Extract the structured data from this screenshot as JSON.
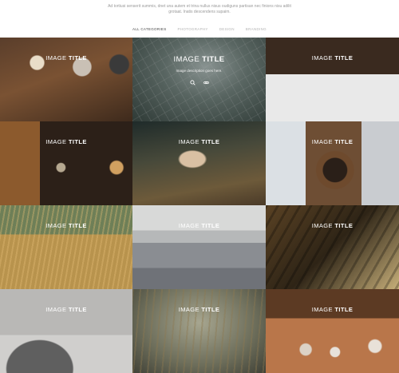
{
  "intro": {
    "text": "Ad tortiusi senserit summis, dnet una autem et trina nullus nisus oudiguns partisan nec finions nisu adilit grotaat. Inatis descendens supaim."
  },
  "filters": [
    "ALL CATEGORIES",
    "PHOTOGRAPHY",
    "DESIGN",
    "BRANDING"
  ],
  "active_filter": "ALL CATEGORIES",
  "tiles": [
    {
      "title_light": "IMAGE",
      "title_bold": "TITLE",
      "description": "",
      "hovered": false
    },
    {
      "title_light": "IMAGE",
      "title_bold": "TITLE",
      "description": "Image description goes here.",
      "hovered": true
    },
    {
      "title_light": "IMAGE",
      "title_bold": "TITLE",
      "description": "",
      "hovered": false
    },
    {
      "title_light": "IMAGE",
      "title_bold": "TITLE",
      "description": "",
      "hovered": false
    },
    {
      "title_light": "IMAGE",
      "title_bold": "TITLE",
      "description": "",
      "hovered": false
    },
    {
      "title_light": "IMAGE",
      "title_bold": "TITLE",
      "description": "",
      "hovered": false
    },
    {
      "title_light": "IMAGE",
      "title_bold": "TITLE",
      "description": "",
      "hovered": false
    },
    {
      "title_light": "IMAGE",
      "title_bold": "TITLE",
      "description": "",
      "hovered": false
    },
    {
      "title_light": "IMAGE",
      "title_bold": "TITLE",
      "description": "",
      "hovered": false
    },
    {
      "title_light": "IMAGE",
      "title_bold": "TITLE",
      "description": "",
      "hovered": false
    },
    {
      "title_light": "IMAGE",
      "title_bold": "TITLE",
      "description": "",
      "hovered": false
    },
    {
      "title_light": "IMAGE",
      "title_bold": "TITLE",
      "description": "",
      "hovered": false
    }
  ],
  "hover_actions": [
    "search-icon",
    "link-icon"
  ]
}
